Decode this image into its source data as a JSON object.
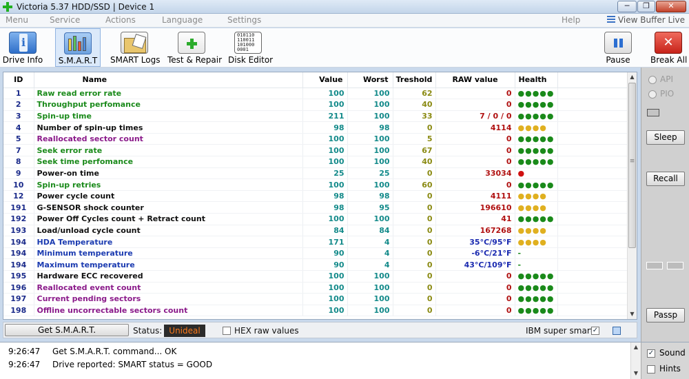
{
  "window": {
    "title": "Victoria 5.37 HDD/SSD | Device 1",
    "min": "─",
    "max": "❐",
    "close": "✕"
  },
  "menu": [
    "Menu",
    "Service",
    "Actions",
    "Language",
    "Settings"
  ],
  "help_label": "Help",
  "view_buffer_label": "View Buffer Live",
  "toolbar": {
    "drive_info": "Drive Info",
    "smart": "S.M.A.R.T",
    "smart_logs": "SMART Logs",
    "test_repair": "Test & Repair",
    "disk_editor": "Disk Editor",
    "disk_editor_icon_text": "010110\n110011\n101000\n0001",
    "pause": "Pause",
    "break_all": "Break All"
  },
  "table": {
    "columns": [
      "ID",
      "Name",
      "Value",
      "Worst",
      "Treshold",
      "RAW value",
      "Health"
    ],
    "rows": [
      {
        "id": "1",
        "name": "Raw read error rate",
        "value": "100",
        "worst": "100",
        "threshold": "62",
        "raw": "0",
        "health": "●●●●●",
        "name_color": "#1a8a1a",
        "health_color": "#1a8a1a"
      },
      {
        "id": "2",
        "name": "Throughput perfomance",
        "value": "100",
        "worst": "100",
        "threshold": "40",
        "raw": "0",
        "health": "●●●●●",
        "name_color": "#1a8a1a",
        "health_color": "#1a8a1a"
      },
      {
        "id": "3",
        "name": "Spin-up time",
        "value": "211",
        "worst": "100",
        "threshold": "33",
        "raw": "7 / 0 / 0",
        "health": "●●●●●",
        "name_color": "#1a8a1a",
        "health_color": "#1a8a1a"
      },
      {
        "id": "4",
        "name": "Number of spin-up times",
        "value": "98",
        "worst": "98",
        "threshold": "0",
        "raw": "4114",
        "health": "●●●●",
        "name_color": "#111111",
        "health_color": "#e0b020"
      },
      {
        "id": "5",
        "name": "Reallocated sector count",
        "value": "100",
        "worst": "100",
        "threshold": "5",
        "raw": "0",
        "health": "●●●●●",
        "name_color": "#8a1a8a",
        "health_color": "#1a8a1a"
      },
      {
        "id": "7",
        "name": "Seek error rate",
        "value": "100",
        "worst": "100",
        "threshold": "67",
        "raw": "0",
        "health": "●●●●●",
        "name_color": "#1a8a1a",
        "health_color": "#1a8a1a"
      },
      {
        "id": "8",
        "name": "Seek time perfomance",
        "value": "100",
        "worst": "100",
        "threshold": "40",
        "raw": "0",
        "health": "●●●●●",
        "name_color": "#1a8a1a",
        "health_color": "#1a8a1a"
      },
      {
        "id": "9",
        "name": "Power-on time",
        "value": "25",
        "worst": "25",
        "threshold": "0",
        "raw": "33034",
        "health": "●",
        "name_color": "#111111",
        "health_color": "#d01010"
      },
      {
        "id": "10",
        "name": "Spin-up retries",
        "value": "100",
        "worst": "100",
        "threshold": "60",
        "raw": "0",
        "health": "●●●●●",
        "name_color": "#1a8a1a",
        "health_color": "#1a8a1a"
      },
      {
        "id": "12",
        "name": "Power cycle count",
        "value": "98",
        "worst": "98",
        "threshold": "0",
        "raw": "4111",
        "health": "●●●●",
        "name_color": "#111111",
        "health_color": "#e0b020"
      },
      {
        "id": "191",
        "name": "G-SENSOR shock counter",
        "value": "98",
        "worst": "95",
        "threshold": "0",
        "raw": "196610",
        "health": "●●●●",
        "name_color": "#111111",
        "health_color": "#e0b020"
      },
      {
        "id": "192",
        "name": "Power Off Cycles count + Retract count",
        "value": "100",
        "worst": "100",
        "threshold": "0",
        "raw": "41",
        "health": "●●●●●",
        "name_color": "#111111",
        "health_color": "#1a8a1a"
      },
      {
        "id": "193",
        "name": "Load/unload cycle count",
        "value": "84",
        "worst": "84",
        "threshold": "0",
        "raw": "167268",
        "health": "●●●●",
        "name_color": "#111111",
        "health_color": "#e0b020"
      },
      {
        "id": "194",
        "name": "HDA Temperature",
        "value": "171",
        "worst": "4",
        "threshold": "0",
        "raw": "35°C/95°F",
        "health": "●●●●",
        "name_color": "#1a3ab0",
        "health_color": "#e0b020"
      },
      {
        "id": "194",
        "name": "Minimum temperature",
        "value": "90",
        "worst": "4",
        "threshold": "0",
        "raw": "-6°C/21°F",
        "health": "-",
        "name_color": "#1a3ab0",
        "health_color": "#1a8a1a"
      },
      {
        "id": "194",
        "name": "Maximum temperature",
        "value": "90",
        "worst": "4",
        "threshold": "0",
        "raw": "43°C/109°F",
        "health": "-",
        "name_color": "#1a3ab0",
        "health_color": "#1a8a1a"
      },
      {
        "id": "195",
        "name": "Hardware ECC recovered",
        "value": "100",
        "worst": "100",
        "threshold": "0",
        "raw": "0",
        "health": "●●●●●",
        "name_color": "#111111",
        "health_color": "#1a8a1a"
      },
      {
        "id": "196",
        "name": "Reallocated event count",
        "value": "100",
        "worst": "100",
        "threshold": "0",
        "raw": "0",
        "health": "●●●●●",
        "name_color": "#8a1a8a",
        "health_color": "#1a8a1a"
      },
      {
        "id": "197",
        "name": "Current pending sectors",
        "value": "100",
        "worst": "100",
        "threshold": "0",
        "raw": "0",
        "health": "●●●●●",
        "name_color": "#8a1a8a",
        "health_color": "#1a8a1a"
      },
      {
        "id": "198",
        "name": "Offline uncorrectable sectors count",
        "value": "100",
        "worst": "100",
        "threshold": "0",
        "raw": "0",
        "health": "●●●●●",
        "name_color": "#8a1a8a",
        "health_color": "#1a8a1a"
      }
    ]
  },
  "status_bar": {
    "get_smart": "Get S.M.A.R.T.",
    "status_label": "Status:",
    "status_value": "Unideal",
    "hex_raw": "HEX raw values",
    "ibm_label": "IBM super smart:",
    "ibm_checked": "✓"
  },
  "side": {
    "api": "API",
    "pio": "PIO",
    "sleep": "Sleep",
    "recall": "Recall",
    "passp": "Passp"
  },
  "log": [
    {
      "time": "9:26:47",
      "text": "Get S.M.A.R.T. command... OK"
    },
    {
      "time": "9:26:47",
      "text": "Drive reported: SMART status = GOOD"
    }
  ],
  "sound": {
    "sound_label": "Sound",
    "sound_checked": "✓",
    "hints_label": "Hints"
  },
  "colors": {
    "value_color": "#138a8a",
    "threshold_color": "#8a8a12",
    "raw_color": "#b01010",
    "raw_temp_color": "#1a2ab0"
  }
}
